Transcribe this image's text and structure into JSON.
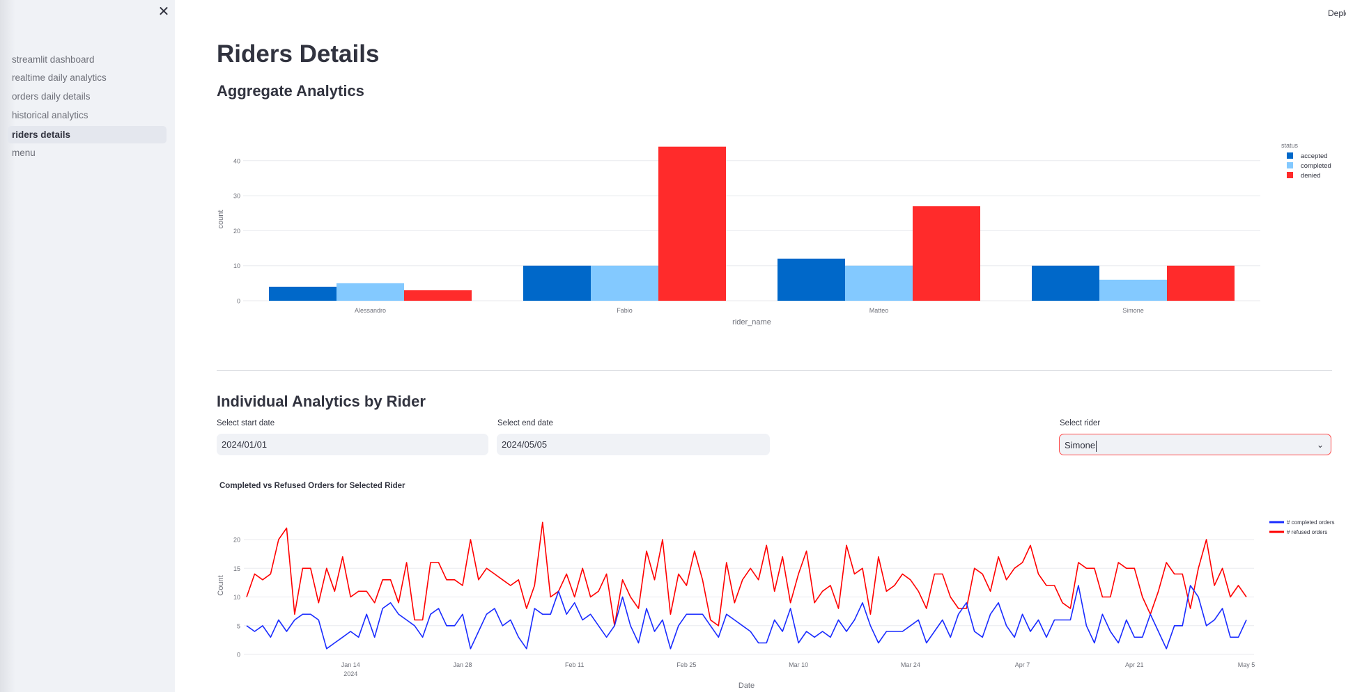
{
  "sidebar": {
    "close_icon": "close-x-icon",
    "items": [
      {
        "label": "streamlit dashboard",
        "active": false
      },
      {
        "label": "realtime daily analytics",
        "active": false
      },
      {
        "label": "orders daily details",
        "active": false
      },
      {
        "label": "historical analytics",
        "active": false
      },
      {
        "label": "riders details",
        "active": true
      },
      {
        "label": "menu",
        "active": false
      }
    ]
  },
  "header": {
    "deploy_label": "Deploy"
  },
  "main": {
    "title": "Riders Details",
    "aggregate_heading": "Aggregate Analytics",
    "individual_heading": "Individual Analytics by Rider",
    "start_date": {
      "label": "Select start date",
      "value": "2024/01/01"
    },
    "end_date": {
      "label": "Select end date",
      "value": "2024/05/05"
    },
    "rider": {
      "label": "Select rider",
      "value": "Simone"
    },
    "line_chart_title": "Completed vs Refused Orders for Selected Rider"
  },
  "chart_data": [
    {
      "type": "bar",
      "barmode": "group",
      "xlabel": "rider_name",
      "ylabel": "count",
      "categories": [
        "Alessandro",
        "Fabio",
        "Matteo",
        "Simone"
      ],
      "yticks": [
        0,
        10,
        20,
        30,
        40
      ],
      "ylim": [
        0,
        46
      ],
      "grid": true,
      "legend_title": "status",
      "legend_position": "top-right",
      "series": [
        {
          "name": "accepted",
          "color": "#0068c9",
          "values": [
            4,
            10,
            12,
            10
          ]
        },
        {
          "name": "completed",
          "color": "#83c9ff",
          "values": [
            5,
            10,
            10,
            6
          ]
        },
        {
          "name": "denied",
          "color": "#ff2b2b",
          "values": [
            3,
            44,
            27,
            10
          ]
        }
      ]
    },
    {
      "type": "line",
      "title": "Completed vs Refused Orders for Selected Rider",
      "xlabel": "Date",
      "ylabel": "Count",
      "xlim": [
        "2024-01-01",
        "2024-05-05"
      ],
      "ylim": [
        0,
        23
      ],
      "yticks": [
        0,
        5,
        10,
        15,
        20
      ],
      "xticks": [
        {
          "date": "2024-01-14",
          "label": "Jan 14",
          "sub": "2024"
        },
        {
          "date": "2024-01-28",
          "label": "Jan 28"
        },
        {
          "date": "2024-02-11",
          "label": "Feb 11"
        },
        {
          "date": "2024-02-25",
          "label": "Feb 25"
        },
        {
          "date": "2024-03-10",
          "label": "Mar 10"
        },
        {
          "date": "2024-03-24",
          "label": "Mar 24"
        },
        {
          "date": "2024-04-07",
          "label": "Apr 7"
        },
        {
          "date": "2024-04-21",
          "label": "Apr 21"
        },
        {
          "date": "2024-05-05",
          "label": "May 5"
        }
      ],
      "grid": true,
      "legend_position": "top-right",
      "x": [
        "2024-01-01",
        "2024-01-02",
        "2024-01-03",
        "2024-01-04",
        "2024-01-05",
        "2024-01-06",
        "2024-01-07",
        "2024-01-08",
        "2024-01-09",
        "2024-01-10",
        "2024-01-11",
        "2024-01-12",
        "2024-01-13",
        "2024-01-14",
        "2024-01-15",
        "2024-01-16",
        "2024-01-17",
        "2024-01-18",
        "2024-01-19",
        "2024-01-20",
        "2024-01-21",
        "2024-01-22",
        "2024-01-23",
        "2024-01-24",
        "2024-01-25",
        "2024-01-26",
        "2024-01-27",
        "2024-01-28",
        "2024-01-29",
        "2024-01-30",
        "2024-01-31",
        "2024-02-01",
        "2024-02-02",
        "2024-02-03",
        "2024-02-04",
        "2024-02-05",
        "2024-02-06",
        "2024-02-07",
        "2024-02-08",
        "2024-02-09",
        "2024-02-10",
        "2024-02-11",
        "2024-02-12",
        "2024-02-13",
        "2024-02-14",
        "2024-02-15",
        "2024-02-16",
        "2024-02-17",
        "2024-02-18",
        "2024-02-19",
        "2024-02-20",
        "2024-02-21",
        "2024-02-22",
        "2024-02-23",
        "2024-02-24",
        "2024-02-25",
        "2024-02-26",
        "2024-02-27",
        "2024-02-28",
        "2024-02-29",
        "2024-03-01",
        "2024-03-02",
        "2024-03-03",
        "2024-03-04",
        "2024-03-05",
        "2024-03-06",
        "2024-03-07",
        "2024-03-08",
        "2024-03-09",
        "2024-03-10",
        "2024-03-11",
        "2024-03-12",
        "2024-03-13",
        "2024-03-14",
        "2024-03-15",
        "2024-03-16",
        "2024-03-17",
        "2024-03-18",
        "2024-03-19",
        "2024-03-20",
        "2024-03-21",
        "2024-03-22",
        "2024-03-23",
        "2024-03-24",
        "2024-03-25",
        "2024-03-26",
        "2024-03-27",
        "2024-03-28",
        "2024-03-29",
        "2024-03-30",
        "2024-03-31",
        "2024-04-01",
        "2024-04-02",
        "2024-04-03",
        "2024-04-04",
        "2024-04-05",
        "2024-04-06",
        "2024-04-07",
        "2024-04-08",
        "2024-04-09",
        "2024-04-10",
        "2024-04-11",
        "2024-04-12",
        "2024-04-13",
        "2024-04-14",
        "2024-04-15",
        "2024-04-16",
        "2024-04-17",
        "2024-04-18",
        "2024-04-19",
        "2024-04-20",
        "2024-04-21",
        "2024-04-22",
        "2024-04-23",
        "2024-04-24",
        "2024-04-25",
        "2024-04-26",
        "2024-04-27",
        "2024-04-28",
        "2024-04-29",
        "2024-04-30",
        "2024-05-01",
        "2024-05-02",
        "2024-05-03",
        "2024-05-04",
        "2024-05-05"
      ],
      "series": [
        {
          "name": "# completed orders",
          "color": "#1a2cff",
          "values": [
            5,
            4,
            5,
            3,
            6,
            4,
            6,
            7,
            7,
            6,
            1,
            2,
            3,
            4,
            3,
            7,
            3,
            8,
            9,
            7,
            6,
            5,
            3,
            7,
            8,
            5,
            5,
            7,
            1,
            4,
            7,
            8,
            5,
            6,
            3,
            1,
            8,
            7,
            7,
            11,
            7,
            9,
            6,
            7,
            5,
            3,
            5,
            10,
            5,
            2,
            8,
            4,
            6,
            1,
            5,
            7,
            7,
            7,
            5,
            3,
            7,
            6,
            5,
            4,
            2,
            2,
            6,
            4,
            8,
            2,
            4,
            3,
            4,
            3,
            6,
            4,
            6,
            9,
            5,
            2,
            4,
            4,
            4,
            5,
            6,
            2,
            4,
            6,
            3,
            7,
            9,
            4,
            3,
            7,
            9,
            5,
            3,
            7,
            4,
            6,
            3,
            6,
            6,
            6,
            12,
            5,
            2,
            7,
            4,
            2,
            6,
            3,
            3,
            7,
            4,
            1,
            5,
            5,
            12,
            10,
            5,
            6,
            8,
            3,
            3,
            6
          ]
        },
        {
          "name": "# refused orders",
          "color": "#ff0000",
          "values": [
            10,
            14,
            13,
            14,
            20,
            22,
            7,
            15,
            15,
            9,
            15,
            11,
            17,
            10,
            11,
            11,
            9,
            13,
            13,
            9,
            16,
            6,
            6,
            16,
            16,
            13,
            13,
            12,
            20,
            13,
            15,
            14,
            13,
            12,
            13,
            8,
            12,
            23,
            10,
            11,
            14,
            10,
            15,
            10,
            11,
            14,
            5,
            13,
            10,
            8,
            18,
            13,
            20,
            7,
            14,
            12,
            18,
            13,
            6,
            5,
            16,
            9,
            13,
            15,
            13,
            19,
            11,
            17,
            9,
            14,
            18,
            9,
            11,
            12,
            8,
            19,
            14,
            15,
            7,
            17,
            11,
            12,
            14,
            13,
            11,
            8,
            14,
            14,
            10,
            8,
            8,
            15,
            14,
            11,
            17,
            13,
            15,
            16,
            19,
            14,
            12,
            12,
            9,
            8,
            16,
            15,
            15,
            10,
            10,
            16,
            15,
            15,
            10,
            7,
            11,
            16,
            14,
            14,
            8,
            15,
            20,
            12,
            15,
            10,
            12,
            10
          ]
        }
      ]
    }
  ]
}
